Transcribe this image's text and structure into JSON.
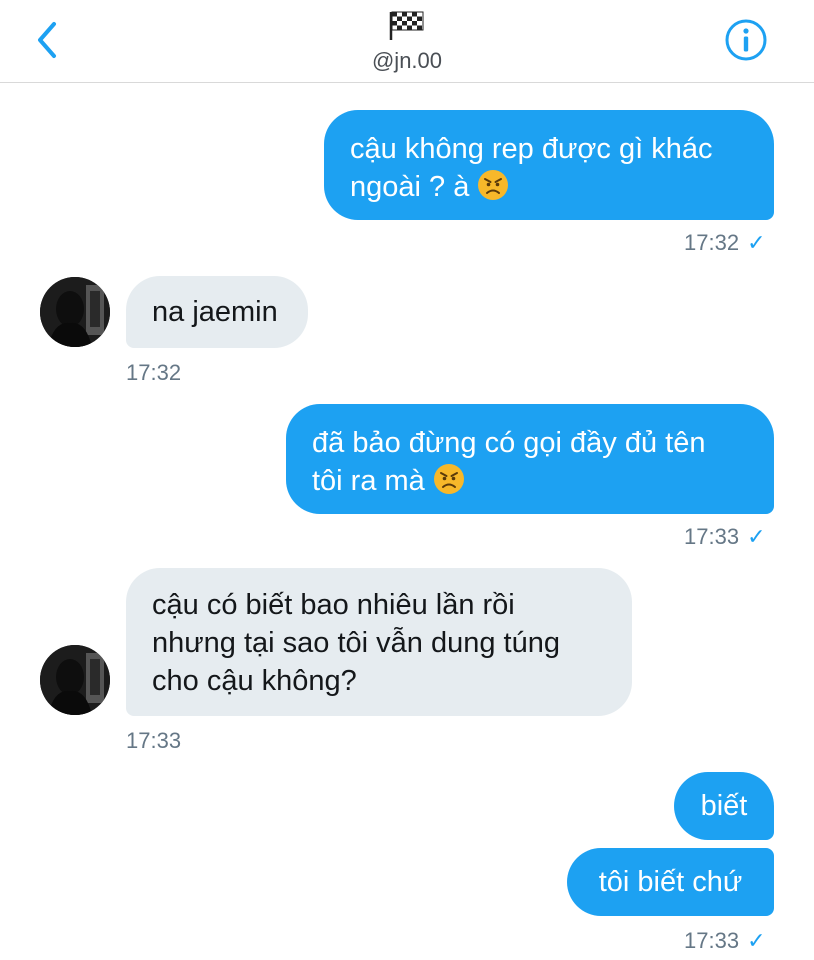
{
  "header": {
    "handle": "@jn.00",
    "back_icon": "chevron-left-icon",
    "info_icon": "info-icon",
    "flag_icon": "checkered-flag-icon",
    "accent": "#1da1f2"
  },
  "messages": [
    {
      "direction": "outgoing",
      "line1": "cậu không rep được gì khác",
      "line2": "ngoài ? à",
      "emoji": "angry-face-emoji",
      "time": "17:32",
      "read_icon": "✓"
    },
    {
      "direction": "incoming",
      "line1": "na jaemin",
      "time": "17:32"
    },
    {
      "direction": "outgoing",
      "line1": "đã bảo đừng có gọi đầy đủ tên",
      "line2": "tôi ra mà",
      "emoji": "angry-face-emoji",
      "time": "17:33",
      "read_icon": "✓"
    },
    {
      "direction": "incoming",
      "line1": "cậu có biết bao nhiêu lần rồi",
      "line2": "nhưng tại sao tôi vẫn dung túng",
      "line3": "cho cậu không?",
      "time": "17:33"
    },
    {
      "direction": "outgoing",
      "line1": "biết"
    },
    {
      "direction": "outgoing",
      "line1": "tôi biết chứ",
      "time": "17:33",
      "read_icon": "✓"
    }
  ],
  "colors": {
    "outgoing_bubble": "#1da1f2",
    "incoming_bubble": "#e6ecf0",
    "timestamp": "#657786"
  }
}
